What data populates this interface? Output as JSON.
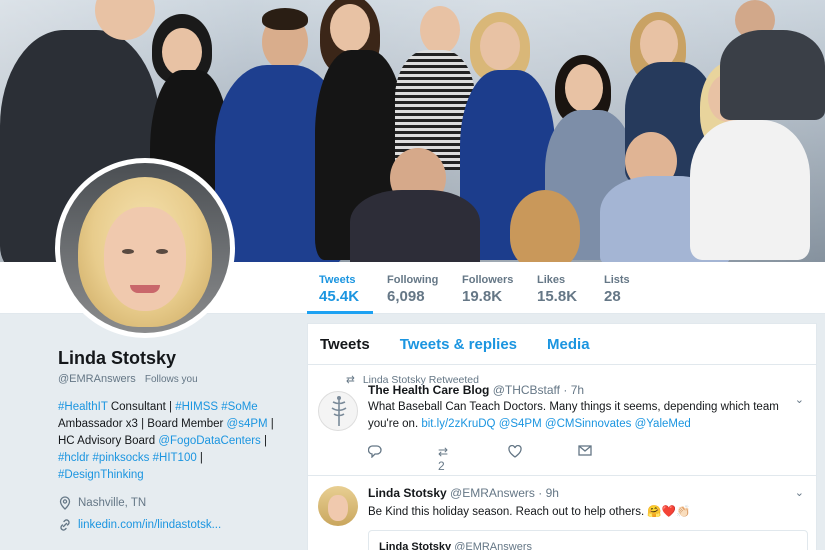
{
  "header": {
    "photo_desc": "group-photo"
  },
  "stats": [
    {
      "label": "Tweets",
      "value": "45.4K",
      "active": true
    },
    {
      "label": "Following",
      "value": "6,098",
      "active": false
    },
    {
      "label": "Followers",
      "value": "19.8K",
      "active": false
    },
    {
      "label": "Likes",
      "value": "15.8K",
      "active": false
    },
    {
      "label": "Lists",
      "value": "28",
      "active": false
    }
  ],
  "profile": {
    "name": "Linda Stotsky",
    "handle": "@EMRAnswers",
    "follows_you": "Follows you",
    "bio": {
      "l1_a": "#HealthIT",
      "l1_b": " Consultant | ",
      "l1_c": "#HIMSS",
      "l1_d": " ",
      "l1_e": "#SoMe",
      "l2_a": "Ambassador x3 | Board Member ",
      "l2_b": "@s4PM",
      "l2_c": " |",
      "l3_a": "HC Advisory Board ",
      "l3_b": "@FogoDataCenters",
      "l3_c": " |",
      "l4_a": "#hcldr",
      "l4_b": " ",
      "l4_c": "#pinksocks",
      "l4_d": " ",
      "l4_e": "#HIT100",
      "l4_f": " |",
      "l5_a": "#DesignThinking"
    },
    "location": "Nashville, TN",
    "website": "linkedin.com/in/lindastotsk..."
  },
  "timeline": {
    "tabs": [
      "Tweets",
      "Tweets & replies",
      "Media"
    ],
    "tweets": [
      {
        "retweet_label": "Linda Stotsky Retweeted",
        "author": "The Health Care Blog",
        "handle": "@THCBstaff",
        "time": "· 7h",
        "text_a": "What Baseball Can Teach Doctors. Many things it seems, depending which team you're on. ",
        "link1": "bit.ly/2zKruDQ",
        "link2": "@S4PM",
        "link3": "@CMSinnovates",
        "link4": "@YaleMed",
        "retweets": "2"
      },
      {
        "author": "Linda Stotsky",
        "handle": "@EMRAnswers",
        "time": "· 9h",
        "text": "Be Kind this holiday season. Reach out to help others. 🤗❤️👏🏻",
        "quote_author": "Linda Stotsky",
        "quote_handle": "@EMRAnswers"
      }
    ]
  },
  "icons": {
    "retweet": "retweet-icon",
    "reply": "reply-icon",
    "like": "heart-icon",
    "dm": "envelope-icon",
    "location": "location-pin-icon",
    "link": "link-icon",
    "caret": "chevron-down-icon"
  },
  "colors": {
    "accent": "#1da1f2",
    "link": "#1b95e0",
    "text": "#14171a",
    "muted": "#657786",
    "background": "#e6ecf0"
  }
}
